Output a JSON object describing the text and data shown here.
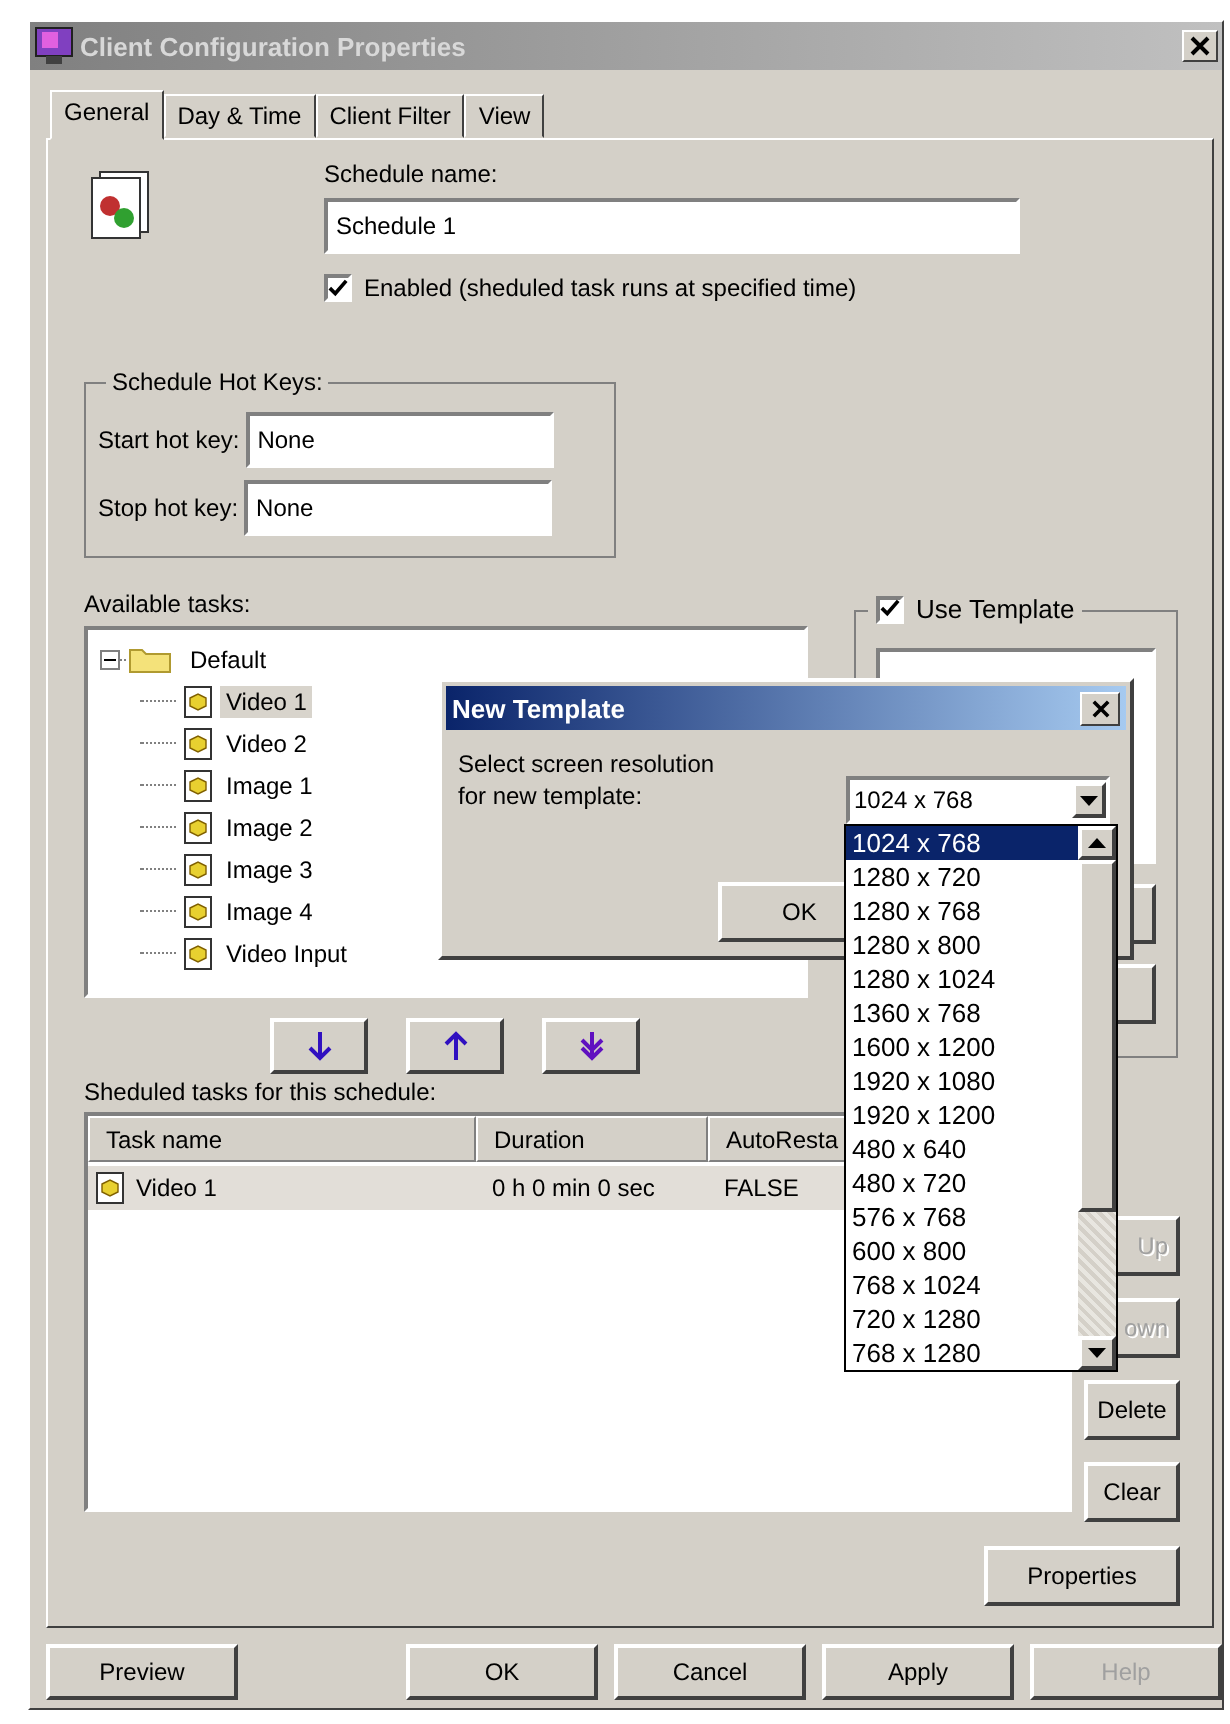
{
  "window": {
    "title": "Client Configuration Properties"
  },
  "tabs": [
    {
      "label": "General",
      "selected": true
    },
    {
      "label": "Day & Time",
      "selected": false
    },
    {
      "label": "Client Filter",
      "selected": false
    },
    {
      "label": "View",
      "selected": false
    }
  ],
  "schedule_name": {
    "label": "Schedule name:",
    "value": "Schedule 1"
  },
  "enabled": {
    "label": "Enabled (sheduled task runs at specified time)",
    "checked": true
  },
  "hot_keys": {
    "title": "Schedule Hot Keys:",
    "fields": [
      {
        "label": "Start hot key:",
        "value": "None"
      },
      {
        "label": "Stop hot key:",
        "value": "None"
      }
    ]
  },
  "available_tasks": {
    "label": "Available tasks:",
    "tree": [
      {
        "label": "Default",
        "kind": "folder",
        "expanded": true,
        "selected": false,
        "children": [
          {
            "label": "Video 1",
            "kind": "task",
            "selected": true
          },
          {
            "label": "Video 2",
            "kind": "task",
            "selected": false
          },
          {
            "label": "Image 1",
            "kind": "task",
            "selected": false
          },
          {
            "label": "Image 2",
            "kind": "task",
            "selected": false
          },
          {
            "label": "Image 3",
            "kind": "task",
            "selected": false
          },
          {
            "label": "Image 4",
            "kind": "task",
            "selected": false
          },
          {
            "label": "Video Input",
            "kind": "task",
            "selected": false
          }
        ]
      }
    ]
  },
  "use_template": {
    "label": "Use Template",
    "checked": true
  },
  "arrow_buttons": [
    {
      "kind": "down"
    },
    {
      "kind": "up"
    },
    {
      "kind": "down-all"
    }
  ],
  "scheduled_tasks": {
    "label": "Sheduled tasks for this schedule:",
    "columns": [
      "Task name",
      "Duration",
      "AutoResta"
    ],
    "rows": [
      {
        "cells": [
          "Video 1",
          "0 h 0 min 0 sec",
          "FALSE"
        ],
        "selected": true
      }
    ]
  },
  "side_buttons": [
    {
      "label": "Up",
      "disabled": true
    },
    {
      "label": "own",
      "disabled": true
    },
    {
      "label": "Delete",
      "disabled": false
    },
    {
      "label": "Clear",
      "disabled": false
    },
    {
      "label": "Properties",
      "disabled": false
    }
  ],
  "footer_buttons": [
    {
      "label": "Preview",
      "disabled": false
    },
    {
      "label": "OK",
      "disabled": false
    },
    {
      "label": "Cancel",
      "disabled": false
    },
    {
      "label": "Apply",
      "disabled": false
    },
    {
      "label": "Help",
      "disabled": true
    }
  ],
  "new_template": {
    "title": "New Template",
    "prompt": [
      "Select screen resolution",
      "for new template:"
    ],
    "value": "1024 x 768",
    "ok": "OK",
    "options": [
      {
        "label": "1024 x 768",
        "selected": true
      },
      {
        "label": "1280 x 720",
        "selected": false
      },
      {
        "label": "1280 x 768",
        "selected": false
      },
      {
        "label": "1280 x 800",
        "selected": false
      },
      {
        "label": "1280 x 1024",
        "selected": false
      },
      {
        "label": "1360 x 768",
        "selected": false
      },
      {
        "label": "1600 x 1200",
        "selected": false
      },
      {
        "label": "1920 x 1080",
        "selected": false
      },
      {
        "label": "1920 x 1200",
        "selected": false
      },
      {
        "label": "480 x 640",
        "selected": false
      },
      {
        "label": "480 x 720",
        "selected": false
      },
      {
        "label": "576 x 768",
        "selected": false
      },
      {
        "label": "600 x 800",
        "selected": false
      },
      {
        "label": "768 x 1024",
        "selected": false
      },
      {
        "label": "720 x 1280",
        "selected": false
      },
      {
        "label": "768 x 1280",
        "selected": false
      }
    ]
  }
}
